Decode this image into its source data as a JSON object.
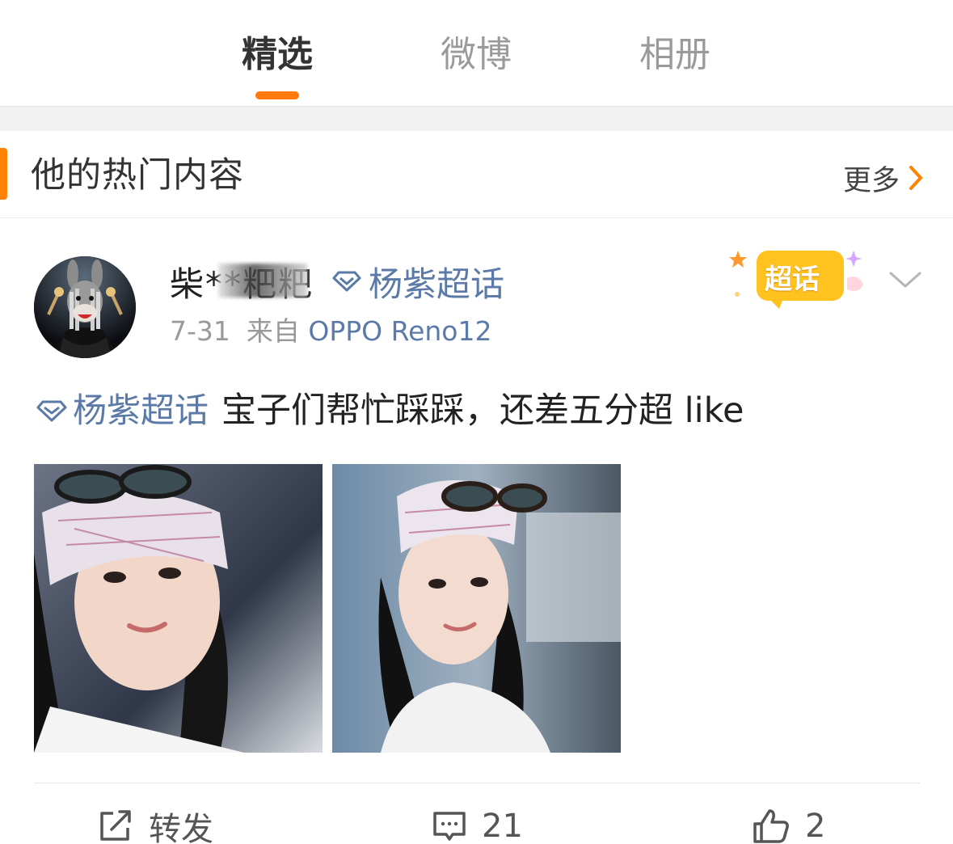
{
  "tabs": [
    {
      "label": "精选",
      "active": true
    },
    {
      "label": "微博",
      "active": false
    },
    {
      "label": "相册",
      "active": false
    }
  ],
  "section": {
    "title": "他的热门内容",
    "more_label": "更多"
  },
  "post": {
    "username": "柴**粑粑",
    "header_topic": "杨紫超话",
    "badge_label": "超话",
    "date": "7-31",
    "source_prefix": "来自",
    "device": "OPPO Reno12",
    "topic": "杨紫超话",
    "body": "宝子们帮忙踩踩，还差五分超 like",
    "images": [
      "photo-1",
      "photo-2"
    ],
    "actions": {
      "repost_label": "转发",
      "comment_count": "21",
      "like_count": "2"
    }
  },
  "colors": {
    "accent": "#ff8200",
    "link": "#5b7aa8",
    "badge": "#ffc21f"
  }
}
